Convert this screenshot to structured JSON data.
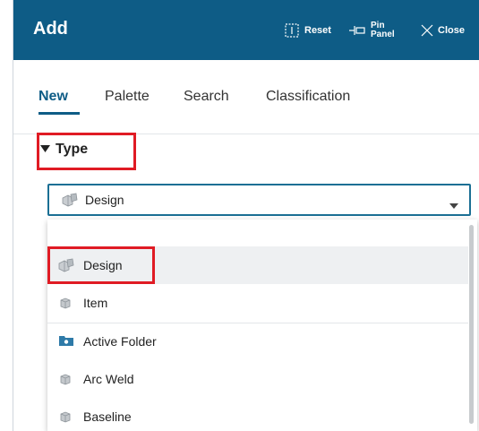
{
  "header": {
    "title": "Add",
    "reset_label": "Reset",
    "pin_label_line1": "Pin",
    "pin_label_line2": "Panel",
    "close_label": "Close"
  },
  "tabs": [
    {
      "label": "New",
      "active": true
    },
    {
      "label": "Palette",
      "active": false
    },
    {
      "label": "Search",
      "active": false
    },
    {
      "label": "Classification",
      "active": false
    }
  ],
  "type_section": {
    "heading": "Type",
    "selected_value": "Design",
    "icon": "design-icon"
  },
  "dropdown": {
    "options": [
      {
        "label": "Design",
        "icon": "design-icon",
        "selected": true
      },
      {
        "label": "Item",
        "icon": "item-icon",
        "selected": false
      },
      {
        "label": "Active Folder",
        "icon": "folder-icon",
        "selected": false
      },
      {
        "label": "Arc Weld",
        "icon": "item-icon",
        "selected": false
      },
      {
        "label": "Baseline",
        "icon": "item-icon",
        "selected": false
      }
    ]
  },
  "colors": {
    "header_bg": "#0e5c86",
    "accent": "#0e5c86",
    "highlight_box": "#e01b24"
  }
}
